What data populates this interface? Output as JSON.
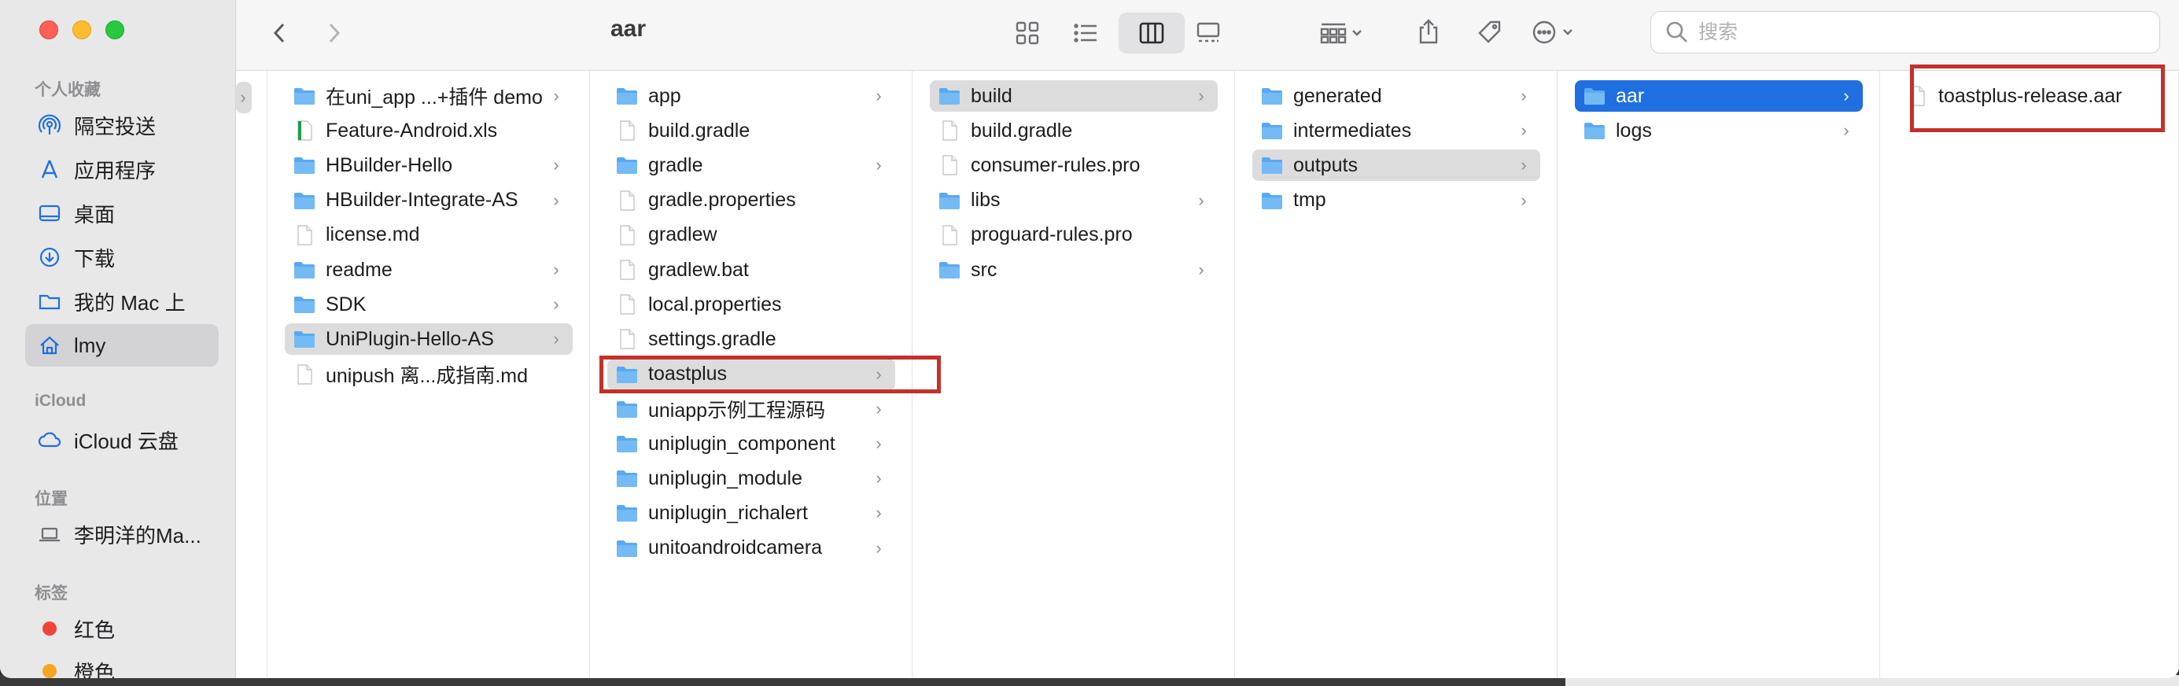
{
  "window": {
    "title": "aar"
  },
  "toolbar": {
    "search_placeholder": "搜索"
  },
  "sidebar": {
    "favorites_header": "个人收藏",
    "favorites": [
      {
        "label": "隔空投送",
        "icon": "airdrop-icon"
      },
      {
        "label": "应用程序",
        "icon": "applications-icon"
      },
      {
        "label": "桌面",
        "icon": "desktop-icon"
      },
      {
        "label": "下载",
        "icon": "downloads-icon"
      },
      {
        "label": "我的 Mac 上",
        "icon": "folder-icon"
      },
      {
        "label": "lmy",
        "icon": "home-icon"
      }
    ],
    "icloud_header": "iCloud",
    "icloud": [
      {
        "label": "iCloud 云盘",
        "icon": "cloud-icon"
      }
    ],
    "locations_header": "位置",
    "locations": [
      {
        "label": "李明洋的Ma...",
        "icon": "laptop-icon"
      }
    ],
    "tags_header": "标签",
    "tags": [
      {
        "label": "红色",
        "color": "#f0443a"
      },
      {
        "label": "橙色",
        "color": "#f5a623"
      }
    ]
  },
  "columns": [
    {
      "items": [
        {
          "name": "在uni_app ...+插件 demo",
          "type": "folder",
          "chevron": true
        },
        {
          "name": "Feature-Android.xls",
          "type": "xls",
          "chevron": false
        },
        {
          "name": "HBuilder-Hello",
          "type": "folder",
          "chevron": true
        },
        {
          "name": "HBuilder-Integrate-AS",
          "type": "folder",
          "chevron": true
        },
        {
          "name": "license.md",
          "type": "file",
          "chevron": false
        },
        {
          "name": "readme",
          "type": "folder",
          "chevron": true
        },
        {
          "name": "SDK",
          "type": "folder",
          "chevron": true
        },
        {
          "name": "UniPlugin-Hello-AS",
          "type": "folder",
          "chevron": true,
          "state": "hl"
        },
        {
          "name": "unipush 离...成指南.md",
          "type": "file",
          "chevron": false
        }
      ]
    },
    {
      "items": [
        {
          "name": "app",
          "type": "folder",
          "chevron": true
        },
        {
          "name": "build.gradle",
          "type": "file",
          "chevron": false
        },
        {
          "name": "gradle",
          "type": "folder",
          "chevron": true
        },
        {
          "name": "gradle.properties",
          "type": "file",
          "chevron": false
        },
        {
          "name": "gradlew",
          "type": "file",
          "chevron": false
        },
        {
          "name": "gradlew.bat",
          "type": "file",
          "chevron": false
        },
        {
          "name": "local.properties",
          "type": "file",
          "chevron": false
        },
        {
          "name": "settings.gradle",
          "type": "file",
          "chevron": false
        },
        {
          "name": "toastplus",
          "type": "folder",
          "chevron": true,
          "state": "hl"
        },
        {
          "name": "uniapp示例工程源码",
          "type": "folder",
          "chevron": true
        },
        {
          "name": "uniplugin_component",
          "type": "folder",
          "chevron": true
        },
        {
          "name": "uniplugin_module",
          "type": "folder",
          "chevron": true
        },
        {
          "name": "uniplugin_richalert",
          "type": "folder",
          "chevron": true
        },
        {
          "name": "unitoandroidcamera",
          "type": "folder",
          "chevron": true
        }
      ]
    },
    {
      "items": [
        {
          "name": "build",
          "type": "folder",
          "chevron": true,
          "state": "hl"
        },
        {
          "name": "build.gradle",
          "type": "file",
          "chevron": false
        },
        {
          "name": "consumer-rules.pro",
          "type": "file",
          "chevron": false
        },
        {
          "name": "libs",
          "type": "folder",
          "chevron": true
        },
        {
          "name": "proguard-rules.pro",
          "type": "file",
          "chevron": false
        },
        {
          "name": "src",
          "type": "folder",
          "chevron": true
        }
      ]
    },
    {
      "items": [
        {
          "name": "generated",
          "type": "folder",
          "chevron": true
        },
        {
          "name": "intermediates",
          "type": "folder",
          "chevron": true
        },
        {
          "name": "outputs",
          "type": "folder",
          "chevron": true,
          "state": "hl"
        },
        {
          "name": "tmp",
          "type": "folder",
          "chevron": true
        }
      ]
    },
    {
      "items": [
        {
          "name": "aar",
          "type": "folder",
          "chevron": true,
          "state": "sel"
        },
        {
          "name": "logs",
          "type": "folder",
          "chevron": true
        }
      ]
    },
    {
      "items": [
        {
          "name": "toastplus-release.aar",
          "type": "file",
          "chevron": false
        }
      ]
    }
  ]
}
